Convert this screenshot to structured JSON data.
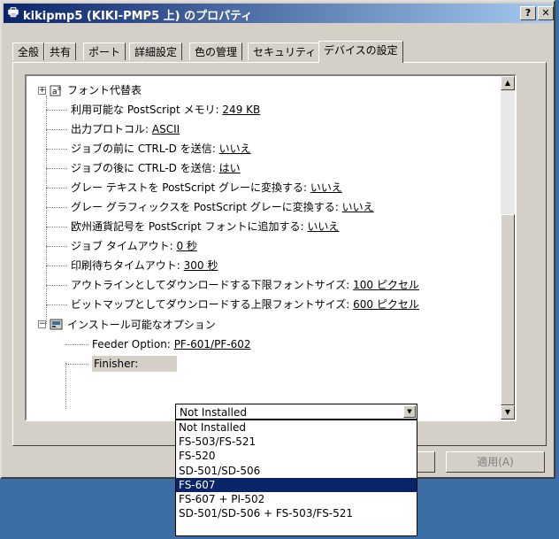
{
  "window": {
    "title": "kikipmp5 (KIKI-PMP5 上) のプロパティ",
    "help_button": "?",
    "close_button": "✕"
  },
  "tabs": [
    {
      "label": "全般"
    },
    {
      "label": "共有"
    },
    {
      "label": "ポート"
    },
    {
      "label": "詳細設定"
    },
    {
      "label": "色の管理"
    },
    {
      "label": "セキュリティ"
    },
    {
      "label": "デバイスの設定"
    }
  ],
  "active_tab": "デバイスの設定",
  "tree": {
    "font_substitution": "フォント代替表",
    "settings": [
      {
        "label": "利用可能な PostScript メモリ:",
        "value": "249 KB"
      },
      {
        "label": "出力プロトコル:",
        "value": "ASCII"
      },
      {
        "label": "ジョブの前に CTRL-D を送信:",
        "value": "いいえ"
      },
      {
        "label": "ジョブの後に CTRL-D を送信:",
        "value": "はい"
      },
      {
        "label": "グレー テキストを PostScript グレーに変換する:",
        "value": "いいえ"
      },
      {
        "label": "グレー グラフィックスを PostScript グレーに変換する:",
        "value": "いいえ"
      },
      {
        "label": "欧州通貨記号を PostScript フォントに追加する:",
        "value": "いいえ"
      },
      {
        "label": "ジョブ タイムアウト:",
        "value": "0 秒"
      },
      {
        "label": "印刷待ちタイムアウト:",
        "value": "300 秒"
      },
      {
        "label": "アウトラインとしてダウンロードする下限フォントサイズ:",
        "value": "100 ピクセル"
      },
      {
        "label": "ビットマップとしてダウンロードする上限フォントサイズ:",
        "value": "600 ピクセル"
      }
    ],
    "installable_options": "インストール可能なオプション",
    "feeder_option": {
      "label": "Feeder Option:",
      "value": "PF-601/PF-602"
    },
    "finisher": {
      "label": "Finisher:",
      "value": "Not Installed"
    }
  },
  "finisher_options": [
    "Not Installed",
    "FS-503/FS-521",
    "FS-520",
    "SD-501/SD-506",
    "FS-607",
    "FS-607 + PI-502",
    "SD-501/SD-506 + FS-503/FS-521"
  ],
  "highlighted_option": "FS-607",
  "buttons": {
    "apply": "適用(A)"
  },
  "icons": {
    "title": "printer-icon",
    "font_node": "font-icon",
    "options_node": "options-icon"
  },
  "colors": {
    "title_start": "#0a246a",
    "title_end": "#a6caf0",
    "selection": "#0a246a",
    "face": "#d4d0c8",
    "desktop": "#3a6ea5"
  }
}
